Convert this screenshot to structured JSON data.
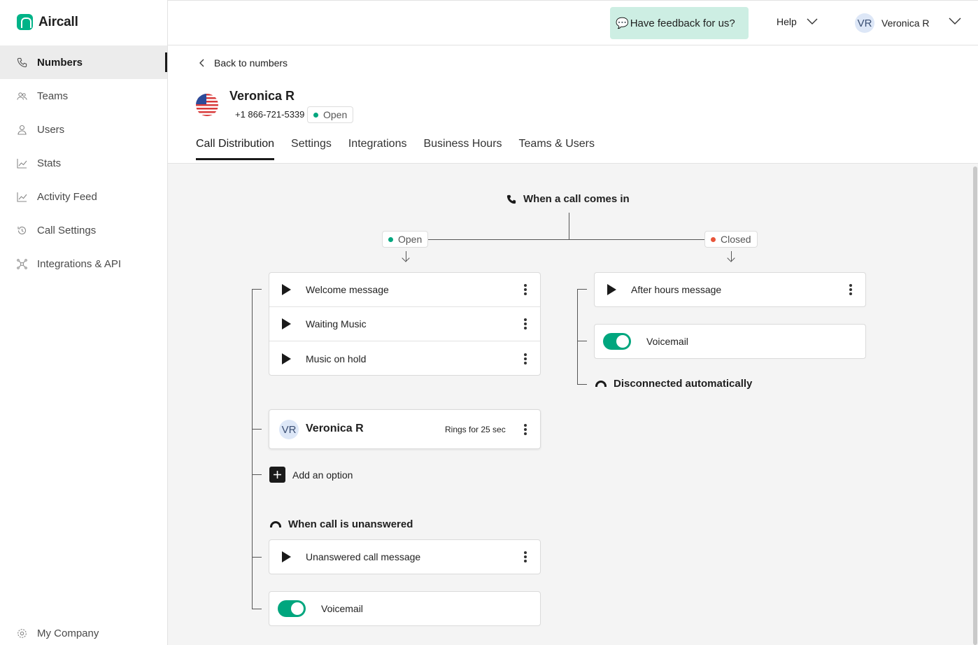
{
  "app": {
    "name": "Aircall",
    "brand_color": "#00b388"
  },
  "sidebar": {
    "items": [
      {
        "label": "Numbers",
        "icon": "phone-icon",
        "active": true
      },
      {
        "label": "Teams",
        "icon": "teams-icon"
      },
      {
        "label": "Users",
        "icon": "user-icon"
      },
      {
        "label": "Stats",
        "icon": "stats-icon"
      },
      {
        "label": "Activity Feed",
        "icon": "activity-icon"
      },
      {
        "label": "Call Settings",
        "icon": "call-settings-icon"
      },
      {
        "label": "Integrations & API",
        "icon": "integrations-icon"
      }
    ],
    "bottom": {
      "label": "My Company",
      "icon": "gear-icon"
    }
  },
  "header": {
    "feedback": "Have feedback for us?",
    "help": "Help",
    "user": {
      "initials": "VR",
      "name": "Veronica R"
    }
  },
  "page": {
    "back": "Back to numbers",
    "number_name": "Veronica R",
    "phone": "+1 866-721-5339",
    "status": "Open",
    "tabs": [
      "Call Distribution",
      "Settings",
      "Integrations",
      "Business Hours",
      "Teams & Users"
    ]
  },
  "flow": {
    "incoming": "When a call comes in",
    "open_label": "Open",
    "closed_label": "Closed",
    "open_color": "#00a67e",
    "closed_color": "#e8553a",
    "open_messages": [
      "Welcome message",
      "Waiting Music",
      "Music on hold"
    ],
    "agent": {
      "initials": "VR",
      "name": "Veronica R",
      "ring": "Rings for 25 sec"
    },
    "add_option": "Add an option",
    "unanswered_title": "When call is unanswered",
    "unanswered_message": "Unanswered call message",
    "voicemail": "Voicemail",
    "closed_message": "After hours message",
    "closed_voicemail": "Voicemail",
    "disconnected": "Disconnected automatically"
  }
}
